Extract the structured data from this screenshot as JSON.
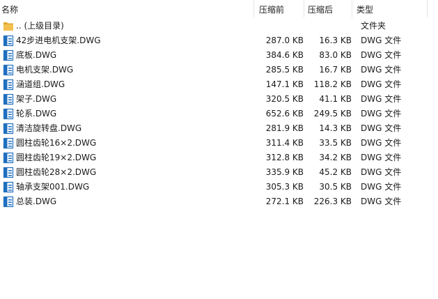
{
  "columns": {
    "name": "名称",
    "size": "压缩前",
    "compressed": "压缩后",
    "type": "类型"
  },
  "colors": {
    "folder": "#f3c04f",
    "file_icon": "#1f6fbf"
  },
  "rows": [
    {
      "icon": "folder-icon",
      "name": ".. (上级目录)",
      "size": "",
      "compressed": "",
      "type": "文件夹"
    },
    {
      "icon": "dwg-file-icon",
      "name": "42步进电机支架.DWG",
      "size": "287.0 KB",
      "compressed": "16.3 KB",
      "type": "DWG 文件"
    },
    {
      "icon": "dwg-file-icon",
      "name": "底板.DWG",
      "size": "384.6 KB",
      "compressed": "83.0 KB",
      "type": "DWG 文件"
    },
    {
      "icon": "dwg-file-icon",
      "name": "电机支架.DWG",
      "size": "285.5 KB",
      "compressed": "16.7 KB",
      "type": "DWG 文件"
    },
    {
      "icon": "dwg-file-icon",
      "name": "涵道组.DWG",
      "size": "147.1 KB",
      "compressed": "118.2 KB",
      "type": "DWG 文件"
    },
    {
      "icon": "dwg-file-icon",
      "name": "架子.DWG",
      "size": "320.5 KB",
      "compressed": "41.1 KB",
      "type": "DWG 文件"
    },
    {
      "icon": "dwg-file-icon",
      "name": "轮系.DWG",
      "size": "652.6 KB",
      "compressed": "249.5 KB",
      "type": "DWG 文件"
    },
    {
      "icon": "dwg-file-icon",
      "name": "清洁旋转盘.DWG",
      "size": "281.9 KB",
      "compressed": "14.3 KB",
      "type": "DWG 文件"
    },
    {
      "icon": "dwg-file-icon",
      "name": "圆柱齿轮16×2.DWG",
      "size": "311.4 KB",
      "compressed": "33.5 KB",
      "type": "DWG 文件"
    },
    {
      "icon": "dwg-file-icon",
      "name": "圆柱齿轮19×2.DWG",
      "size": "312.8 KB",
      "compressed": "34.2 KB",
      "type": "DWG 文件"
    },
    {
      "icon": "dwg-file-icon",
      "name": "圆柱齿轮28×2.DWG",
      "size": "335.9 KB",
      "compressed": "45.2 KB",
      "type": "DWG 文件"
    },
    {
      "icon": "dwg-file-icon",
      "name": "轴承支架001.DWG",
      "size": "305.3 KB",
      "compressed": "30.5 KB",
      "type": "DWG 文件"
    },
    {
      "icon": "dwg-file-icon",
      "name": "总装.DWG",
      "size": "272.1 KB",
      "compressed": "226.3 KB",
      "type": "DWG 文件"
    }
  ]
}
